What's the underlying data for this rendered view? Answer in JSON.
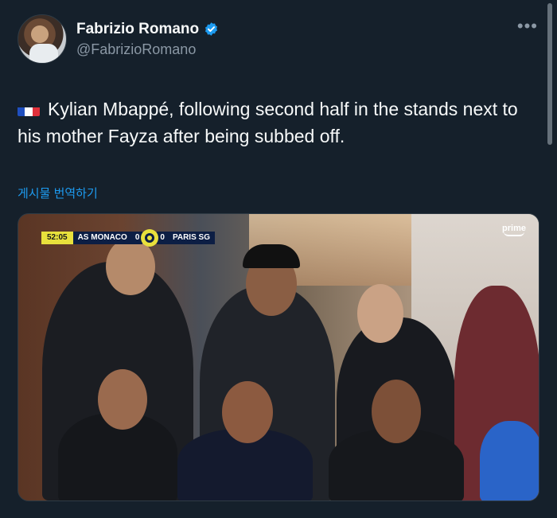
{
  "author": {
    "display_name": "Fabrizio Romano",
    "handle": "@FabrizioRomano",
    "verified": true
  },
  "icons": [
    "avatar-image",
    "verified-badge-icon",
    "more-options-icon",
    "france-flag-icon",
    "ligue1-logo-icon",
    "prime-video-logo-icon"
  ],
  "tweet": {
    "text": "Kylian Mbappé, following second half in the stands next to his mother Fayza after being subbed off.",
    "translate_label": "게시물 번역하기"
  },
  "media": {
    "scoreboard": {
      "clock": "52:05",
      "home_team": "AS MONACO",
      "home_score": "0",
      "away_score": "0",
      "away_team": "PARIS SG"
    },
    "broadcaster": "prime"
  },
  "colors": {
    "background": "#15202b",
    "link": "#1d9bf0",
    "verified": "#1d9bf0",
    "secondary_text": "#8b98a5",
    "score_clock": "#e8e03c",
    "score_bar": "#0c1e44"
  }
}
